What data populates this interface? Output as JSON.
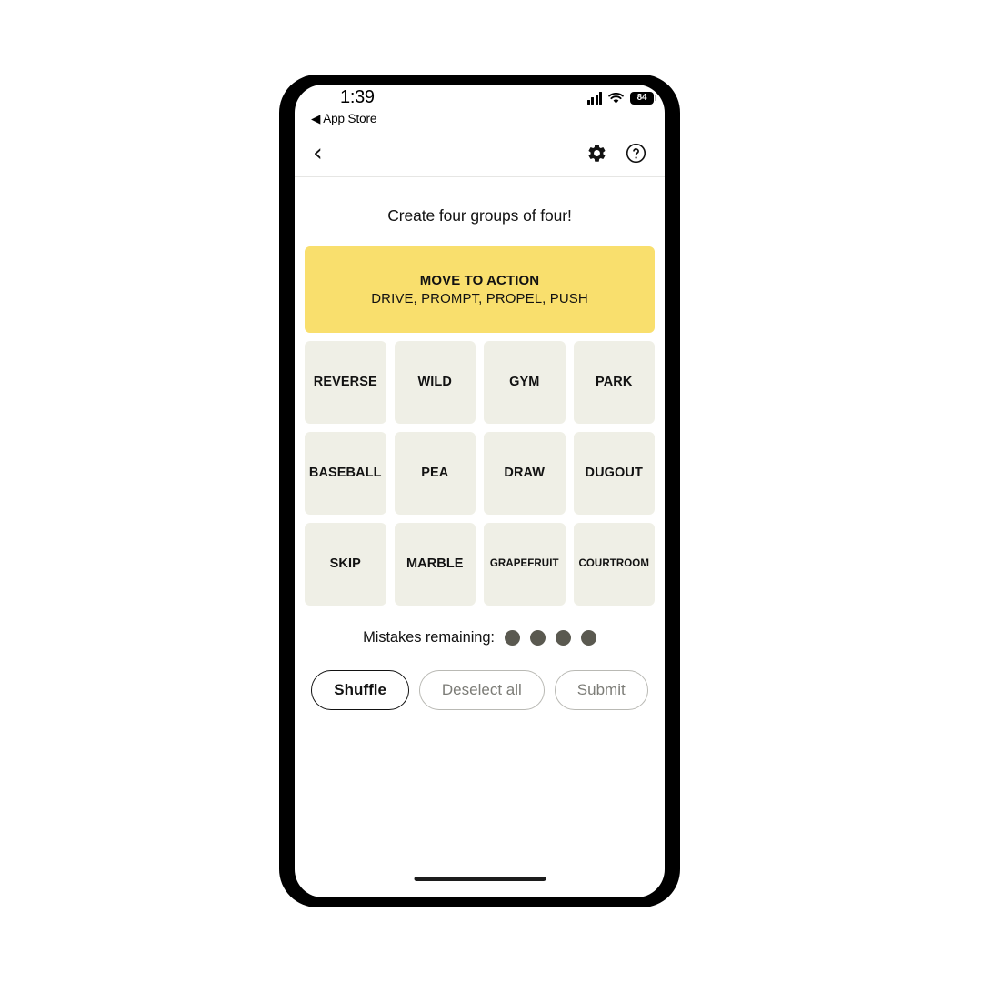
{
  "status_bar": {
    "time": "1:39",
    "back_app": "◀ App Store",
    "battery_level": "84",
    "signal_icon": "cellular-signal-icon",
    "wifi_icon": "wifi-icon",
    "battery_icon": "battery-icon"
  },
  "nav_bar": {
    "back_label": "‹",
    "settings_icon": "gear-icon",
    "help_icon": "help-circle-icon"
  },
  "game": {
    "prompt": "Create four groups of four!",
    "solved_groups": [
      {
        "title": "MOVE TO ACTION",
        "members": "DRIVE, PROMPT, PROPEL, PUSH",
        "color": "#f9df6d"
      }
    ],
    "tiles": [
      {
        "label": "REVERSE",
        "size": "normal"
      },
      {
        "label": "WILD",
        "size": "normal"
      },
      {
        "label": "GYM",
        "size": "normal"
      },
      {
        "label": "PARK",
        "size": "normal"
      },
      {
        "label": "BASEBALL",
        "size": "normal"
      },
      {
        "label": "PEA",
        "size": "normal"
      },
      {
        "label": "DRAW",
        "size": "normal"
      },
      {
        "label": "DUGOUT",
        "size": "normal"
      },
      {
        "label": "SKIP",
        "size": "normal"
      },
      {
        "label": "MARBLE",
        "size": "normal"
      },
      {
        "label": "GRAPEFRUIT",
        "size": "small"
      },
      {
        "label": "COURTROOM",
        "size": "small"
      }
    ],
    "mistakes": {
      "label": "Mistakes remaining:",
      "remaining": 4,
      "dot_color": "#5a5950"
    },
    "buttons": [
      {
        "label": "Shuffle",
        "style": "primary"
      },
      {
        "label": "Deselect all",
        "style": "muted"
      },
      {
        "label": "Submit",
        "style": "muted"
      }
    ]
  }
}
